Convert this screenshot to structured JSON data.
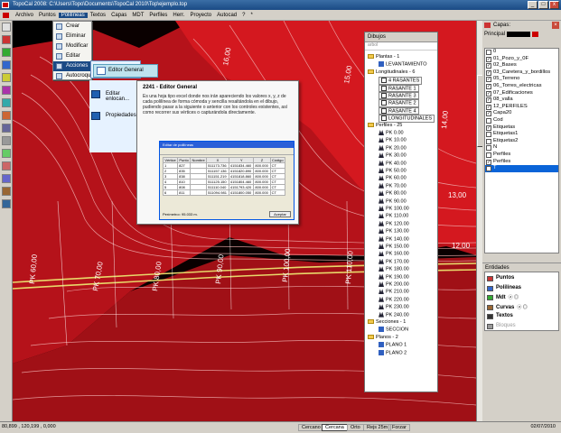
{
  "window": {
    "title": "TopoCal 2008: C:\\Users\\Topo\\Documents\\TopoCal 2010\\Top\\ejemplo.top",
    "buttons": [
      "_",
      "□",
      "x"
    ]
  },
  "menu": [
    "Archivo",
    "Puntos",
    "Polilíneas",
    "Textos",
    "Capas",
    "MDT",
    "Perfiles",
    "Herr.",
    "Proyecto",
    "Autocad",
    "?",
    "*"
  ],
  "dropdown": {
    "items": [
      "Crear",
      "Eliminar",
      "Modificar",
      "Editar",
      "Acciones",
      "Autocroquis"
    ],
    "submenu": [
      "Editor General",
      "Editar enlocan...",
      "Propiedades"
    ]
  },
  "tooltip": {
    "title": "2241 - Editor General",
    "body": "Es una hoja tipo excel donde nos irán apareciendo los valores x, y, z de cada polilínea de forma cómoda y sencilla resaltándola en el dibujo, pudiendo pasar a la siguiente o anterior con los controles existentes, así como recorrer sus vértices o capturándola directamente.",
    "shot": {
      "title": "Editar de polilíneas",
      "headers": [
        "Vértice",
        "Punto",
        "Nombre",
        "X",
        "Y",
        "Z",
        "Código"
      ],
      "rows": [
        [
          "1",
          "827",
          "",
          "511173.736",
          "4151834.460",
          "800.000",
          "CT"
        ],
        [
          "2",
          "835",
          "",
          "511157.136",
          "4151820.890",
          "800.000",
          "CT"
        ],
        [
          "3",
          "838",
          "",
          "511151.219",
          "4151818.860",
          "800.000",
          "CT"
        ],
        [
          "4",
          "810",
          "",
          "511125.150",
          "4151804.460",
          "800.000",
          "CT"
        ],
        [
          "5",
          "808",
          "",
          "511110.040",
          "4151793.420",
          "800.000",
          "CT"
        ],
        [
          "6",
          "811",
          "",
          "511094.981",
          "4151800.050",
          "800.000",
          "CT"
        ]
      ],
      "footer": "Perímetro= 95.033 m.",
      "ok": "Aceptar"
    }
  },
  "canvas": {
    "pk_labels": [
      "PK 60,00",
      "PK 70,00",
      "PK 80,00",
      "PK 90,00",
      "PK 100,00",
      "PK 110,00"
    ],
    "contour_labels": [
      "16,00",
      "15,00",
      "14,00",
      "13,00",
      "12,00"
    ]
  },
  "dibujos": {
    "title": "Dibujos",
    "subtitle": "arbol",
    "nodes": [
      {
        "text": "Plantas - 1",
        "kind": "folder",
        "indent": 0
      },
      {
        "text": "LEVANTAMIENTO",
        "kind": "plant",
        "indent": 1
      },
      {
        "text": "Longitudinales - 6",
        "kind": "folder",
        "indent": 0
      },
      {
        "text": "4 RASANTES",
        "kind": "box",
        "indent": 1
      },
      {
        "text": "RASANTE 1",
        "kind": "box",
        "indent": 1
      },
      {
        "text": "RASANTE 3",
        "kind": "box",
        "indent": 1
      },
      {
        "text": "RASANTE 2",
        "kind": "box",
        "indent": 1
      },
      {
        "text": "RASANTE 4",
        "kind": "box",
        "indent": 1
      },
      {
        "text": "LONGITUDINALES",
        "kind": "box",
        "indent": 1
      },
      {
        "text": "Perfiles - 25",
        "kind": "folder",
        "indent": 0
      },
      {
        "text": "PK 0.00",
        "kind": "pk",
        "indent": 1
      },
      {
        "text": "PK 10.00",
        "kind": "pk",
        "indent": 1
      },
      {
        "text": "PK 20.00",
        "kind": "pk",
        "indent": 1
      },
      {
        "text": "PK 30.00",
        "kind": "pk",
        "indent": 1
      },
      {
        "text": "PK 40.00",
        "kind": "pk",
        "indent": 1
      },
      {
        "text": "PK 50.00",
        "kind": "pk",
        "indent": 1
      },
      {
        "text": "PK 60.00",
        "kind": "pk",
        "indent": 1
      },
      {
        "text": "PK 70.00",
        "kind": "pk",
        "indent": 1
      },
      {
        "text": "PK 80.00",
        "kind": "pk",
        "indent": 1
      },
      {
        "text": "PK 90.00",
        "kind": "pk",
        "indent": 1
      },
      {
        "text": "PK 100.00",
        "kind": "pk",
        "indent": 1
      },
      {
        "text": "PK 110.00",
        "kind": "pk",
        "indent": 1
      },
      {
        "text": "PK 120.00",
        "kind": "pk",
        "indent": 1
      },
      {
        "text": "PK 130.00",
        "kind": "pk",
        "indent": 1
      },
      {
        "text": "PK 140.00",
        "kind": "pk",
        "indent": 1
      },
      {
        "text": "PK 150.00",
        "kind": "pk",
        "indent": 1
      },
      {
        "text": "PK 160.00",
        "kind": "pk",
        "indent": 1
      },
      {
        "text": "PK 170.00",
        "kind": "pk",
        "indent": 1
      },
      {
        "text": "PK 180.00",
        "kind": "pk",
        "indent": 1
      },
      {
        "text": "PK 190.00",
        "kind": "pk",
        "indent": 1
      },
      {
        "text": "PK 200.00",
        "kind": "pk",
        "indent": 1
      },
      {
        "text": "PK 210.00",
        "kind": "pk",
        "indent": 1
      },
      {
        "text": "PK 220.00",
        "kind": "pk",
        "indent": 1
      },
      {
        "text": "PK 230.00",
        "kind": "pk",
        "indent": 1
      },
      {
        "text": "PK 240.00",
        "kind": "pk",
        "indent": 1
      },
      {
        "text": "Secciones - 1",
        "kind": "folder",
        "indent": 0
      },
      {
        "text": "SECCION",
        "kind": "plan",
        "indent": 1
      },
      {
        "text": "Planos - 2",
        "kind": "folder",
        "indent": 0
      },
      {
        "text": "PLANO 1",
        "kind": "plan",
        "indent": 1
      },
      {
        "text": "PLANO 2",
        "kind": "plan",
        "indent": 1
      }
    ]
  },
  "capas": {
    "title": "Capas:",
    "current": "Principal",
    "items": [
      {
        "name": "0",
        "checked": false
      },
      {
        "name": "01_Pozo_y_0F",
        "checked": true
      },
      {
        "name": "02_Bases",
        "checked": true
      },
      {
        "name": "03_Caretera_y_bordillos",
        "checked": true
      },
      {
        "name": "05_Terreno",
        "checked": true
      },
      {
        "name": "06_Torres_electricas",
        "checked": true
      },
      {
        "name": "07_Edificaciones",
        "checked": true
      },
      {
        "name": "08_valla",
        "checked": true
      },
      {
        "name": "12_PERFILES",
        "checked": true
      },
      {
        "name": "Capa20",
        "checked": true
      },
      {
        "name": "Cod",
        "checked": false
      },
      {
        "name": "Etiquetas",
        "checked": true
      },
      {
        "name": "Etiquetas1",
        "checked": false
      },
      {
        "name": "Etiquetas2",
        "checked": false
      },
      {
        "name": "N",
        "checked": false
      },
      {
        "name": "Perfiles",
        "checked": false
      },
      {
        "name": "Perfiles",
        "checked": true
      },
      {
        "name": "T",
        "checked": true,
        "selected": true
      }
    ]
  },
  "entidades": {
    "title": "Entidades",
    "items": [
      {
        "label": "Puntos",
        "extra": ""
      },
      {
        "label": "Polilíneas",
        "extra": ""
      },
      {
        "label": "Mdt",
        "extra": "ⓐ ◎"
      },
      {
        "label": "Curvas",
        "extra": "ⓐ ◎"
      },
      {
        "label": "Textos",
        "extra": ""
      },
      {
        "label": "Bloques",
        "extra": ""
      }
    ]
  },
  "status": {
    "coords": "80,899 , 120,199 , 0,000",
    "buttons": [
      "Cercano",
      "Cercana",
      "Orto",
      "Rejs 25m",
      "Forzar"
    ],
    "active_button": "Cercana",
    "date": "02/07/2010"
  },
  "colors": {
    "terrain": "#c8141a",
    "terrain_dark": "#8a0a0e",
    "road": "#e8d86a",
    "selection": "#0a64d8"
  }
}
